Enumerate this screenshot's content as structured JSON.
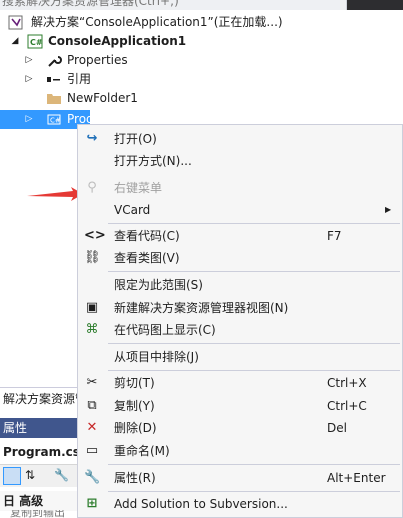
{
  "top_strip": {
    "cut_text": "搜索解决方案资源管理器(Ctrl+;)"
  },
  "tree": {
    "solution": "解决方案“ConsoleApplication1”(正在加载...)",
    "project": "ConsoleApplication1",
    "properties": "Properties",
    "references": "引用",
    "folder": "NewFolder1",
    "program": "Program.cs"
  },
  "bottom_panel": {
    "panel_label": "解决方案资源管",
    "properties_header": "属性",
    "object_name": "Program.cs",
    "category": "日 高级",
    "cut_text": "复制到输出"
  },
  "context_menu": {
    "open": "打开(O)",
    "open_with": "打开方式(N)...",
    "right_click_menu": "右键菜单",
    "vcard": "VCard",
    "view_code": "查看代码(C)",
    "view_code_shortcut": "F7",
    "view_class_diagram": "查看类图(V)",
    "scope_to_this": "限定为此范围(S)",
    "new_explorer_view": "新建解决方案资源管理器视图(N)",
    "show_on_code_map": "在代码图上显示(C)",
    "exclude_from_project": "从项目中排除(J)",
    "cut": "剪切(T)",
    "cut_shortcut": "Ctrl+X",
    "copy": "复制(Y)",
    "copy_shortcut": "Ctrl+C",
    "delete": "删除(D)",
    "delete_shortcut": "Del",
    "rename": "重命名(M)",
    "properties": "属性(R)",
    "properties_shortcut": "Alt+Enter",
    "add_to_svn": "Add Solution to Subversion..."
  },
  "colors": {
    "selection": "#3399ff",
    "menu_bg": "#f6f6f6",
    "arrow": "#e53935",
    "prop_header": "#40568d"
  }
}
